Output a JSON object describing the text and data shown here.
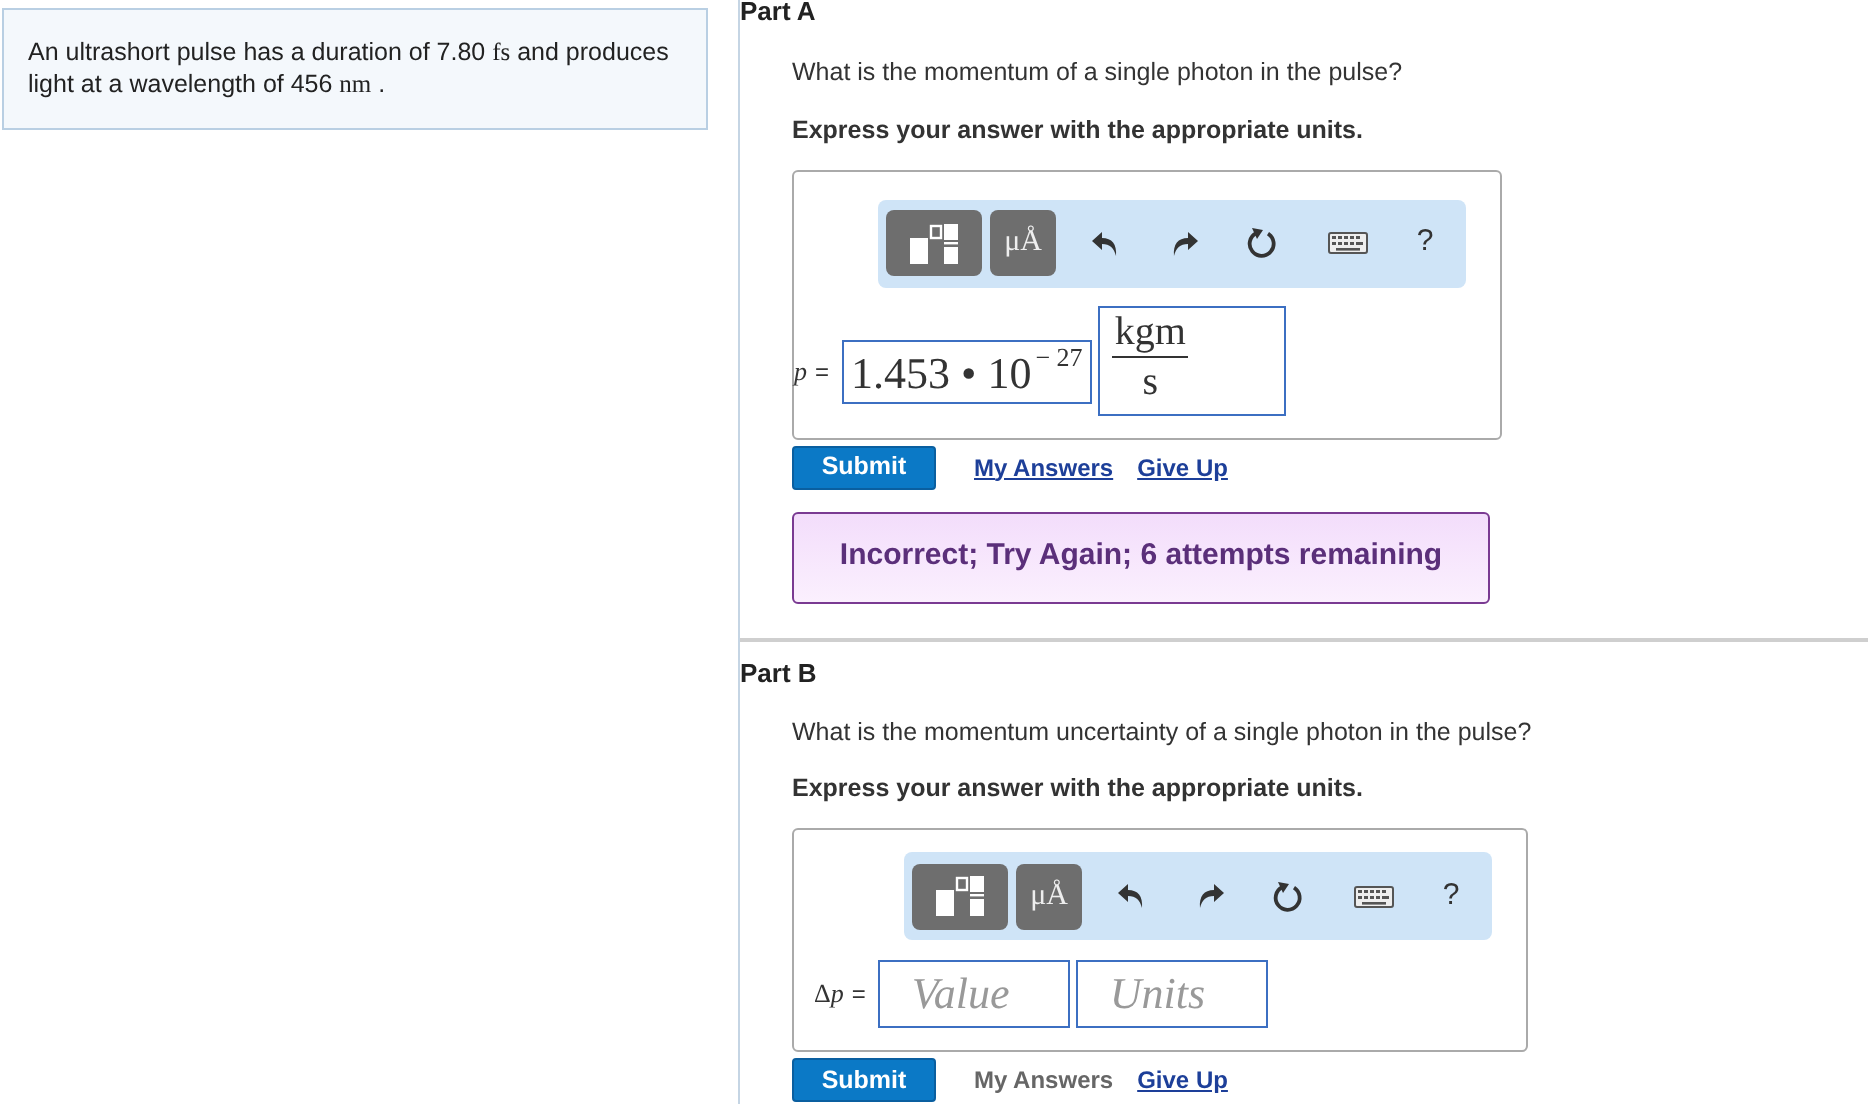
{
  "problem": {
    "text": "An ultrashort pulse has a duration of 7.80 *fs* and produces light at a wavelength of 456 *nm* ."
  },
  "parts": [
    {
      "label": "Part A",
      "question": "What is the momentum of a single photon in the pulse?",
      "instruction": "Express your answer with the appropriate units.",
      "toolbar": {
        "units_label": "μÅ",
        "help": "?"
      },
      "answer": {
        "variable": {
          "symbol": "p",
          "sign": "="
        },
        "value": {
          "mantissa": "1.453 • 10",
          "exponent": "− 27"
        },
        "units": {
          "numerator": "kgm",
          "denominator": "s"
        }
      },
      "links": [
        {
          "kind": "submit",
          "label": "Submit",
          "disabled": false
        },
        {
          "kind": "link",
          "label": "My Answers",
          "disabled": false
        },
        {
          "kind": "link",
          "label": "Give Up",
          "disabled": false
        }
      ],
      "feedback": "Incorrect; Try Again; 6 attempts remaining"
    },
    {
      "label": "Part B",
      "question": "What is the momentum uncertainty of a single photon in the pulse?",
      "instruction": "Express your answer with the appropriate units.",
      "toolbar": {
        "units_label": "μÅ",
        "help": "?"
      },
      "answer": {
        "variable": {
          "prefix": "Δ",
          "symbol": "p",
          "sign": "="
        },
        "value": {
          "placeholder": "Value"
        },
        "units": {
          "placeholder": "Units"
        }
      },
      "links": [
        {
          "kind": "submit",
          "label": "Submit",
          "disabled": false
        },
        {
          "kind": "link",
          "label": "My Answers",
          "disabled": true
        },
        {
          "kind": "link",
          "label": "Give Up",
          "disabled": false
        }
      ]
    }
  ]
}
